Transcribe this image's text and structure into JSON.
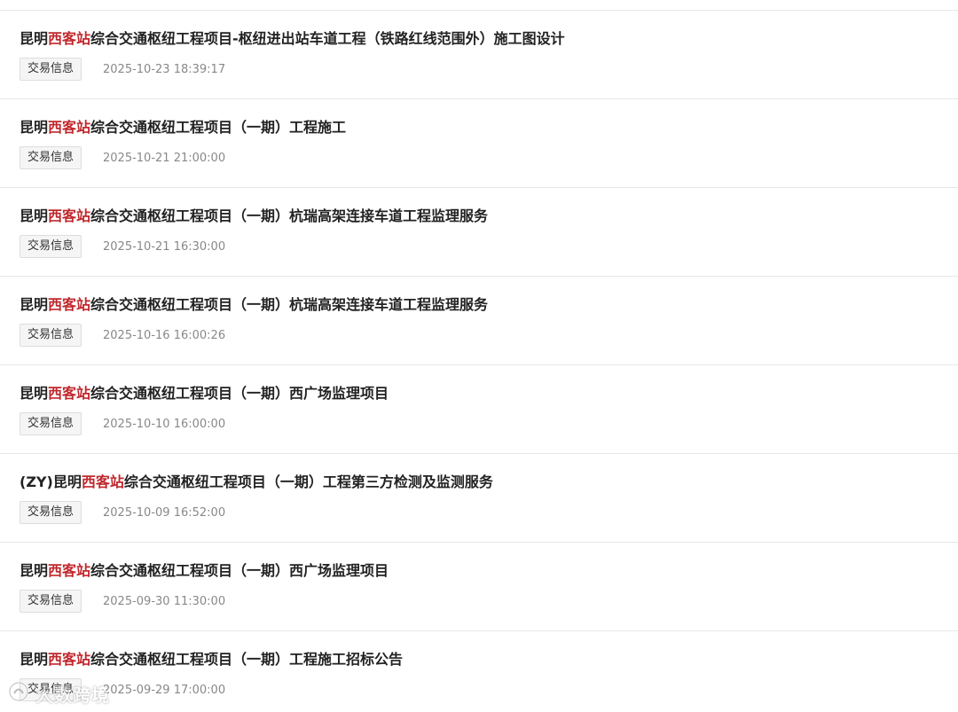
{
  "items": [
    {
      "prefix": "昆明",
      "highlight": "西客站",
      "suffix": "综合交通枢纽工程项目-枢纽进出站车道工程（铁路红线范围外）施工图设计",
      "tag": "交易信息",
      "date": "2025-10-23 18:39:17"
    },
    {
      "prefix": "昆明",
      "highlight": "西客站",
      "suffix": "综合交通枢纽工程项目（一期）工程施工",
      "tag": "交易信息",
      "date": "2025-10-21 21:00:00"
    },
    {
      "prefix": "昆明",
      "highlight": "西客站",
      "suffix": "综合交通枢纽工程项目（一期）杭瑞高架连接车道工程监理服务",
      "tag": "交易信息",
      "date": "2025-10-21 16:30:00"
    },
    {
      "prefix": "昆明",
      "highlight": "西客站",
      "suffix": "综合交通枢纽工程项目（一期）杭瑞高架连接车道工程监理服务",
      "tag": "交易信息",
      "date": "2025-10-16 16:00:26"
    },
    {
      "prefix": "昆明",
      "highlight": "西客站",
      "suffix": "综合交通枢纽工程项目（一期）西广场监理项目",
      "tag": "交易信息",
      "date": "2025-10-10 16:00:00"
    },
    {
      "prefix": "(ZY)昆明",
      "highlight": "西客站",
      "suffix": "综合交通枢纽工程项目（一期）工程第三方检测及监测服务",
      "tag": "交易信息",
      "date": "2025-10-09 16:52:00"
    },
    {
      "prefix": "昆明",
      "highlight": "西客站",
      "suffix": "综合交通枢纽工程项目（一期）西广场监理项目",
      "tag": "交易信息",
      "date": "2025-09-30 11:30:00"
    },
    {
      "prefix": "昆明",
      "highlight": "西客站",
      "suffix": "综合交通枢纽工程项目（一期）工程施工招标公告",
      "tag": "交易信息",
      "date": "2025-09-29 17:00:00"
    }
  ],
  "watermark": {
    "text": "大数跨境",
    "icon": "app-logo-icon"
  },
  "colors": {
    "highlight": "#c0282d",
    "title": "#222222",
    "date": "#888888",
    "divider": "#e6e6e6"
  }
}
